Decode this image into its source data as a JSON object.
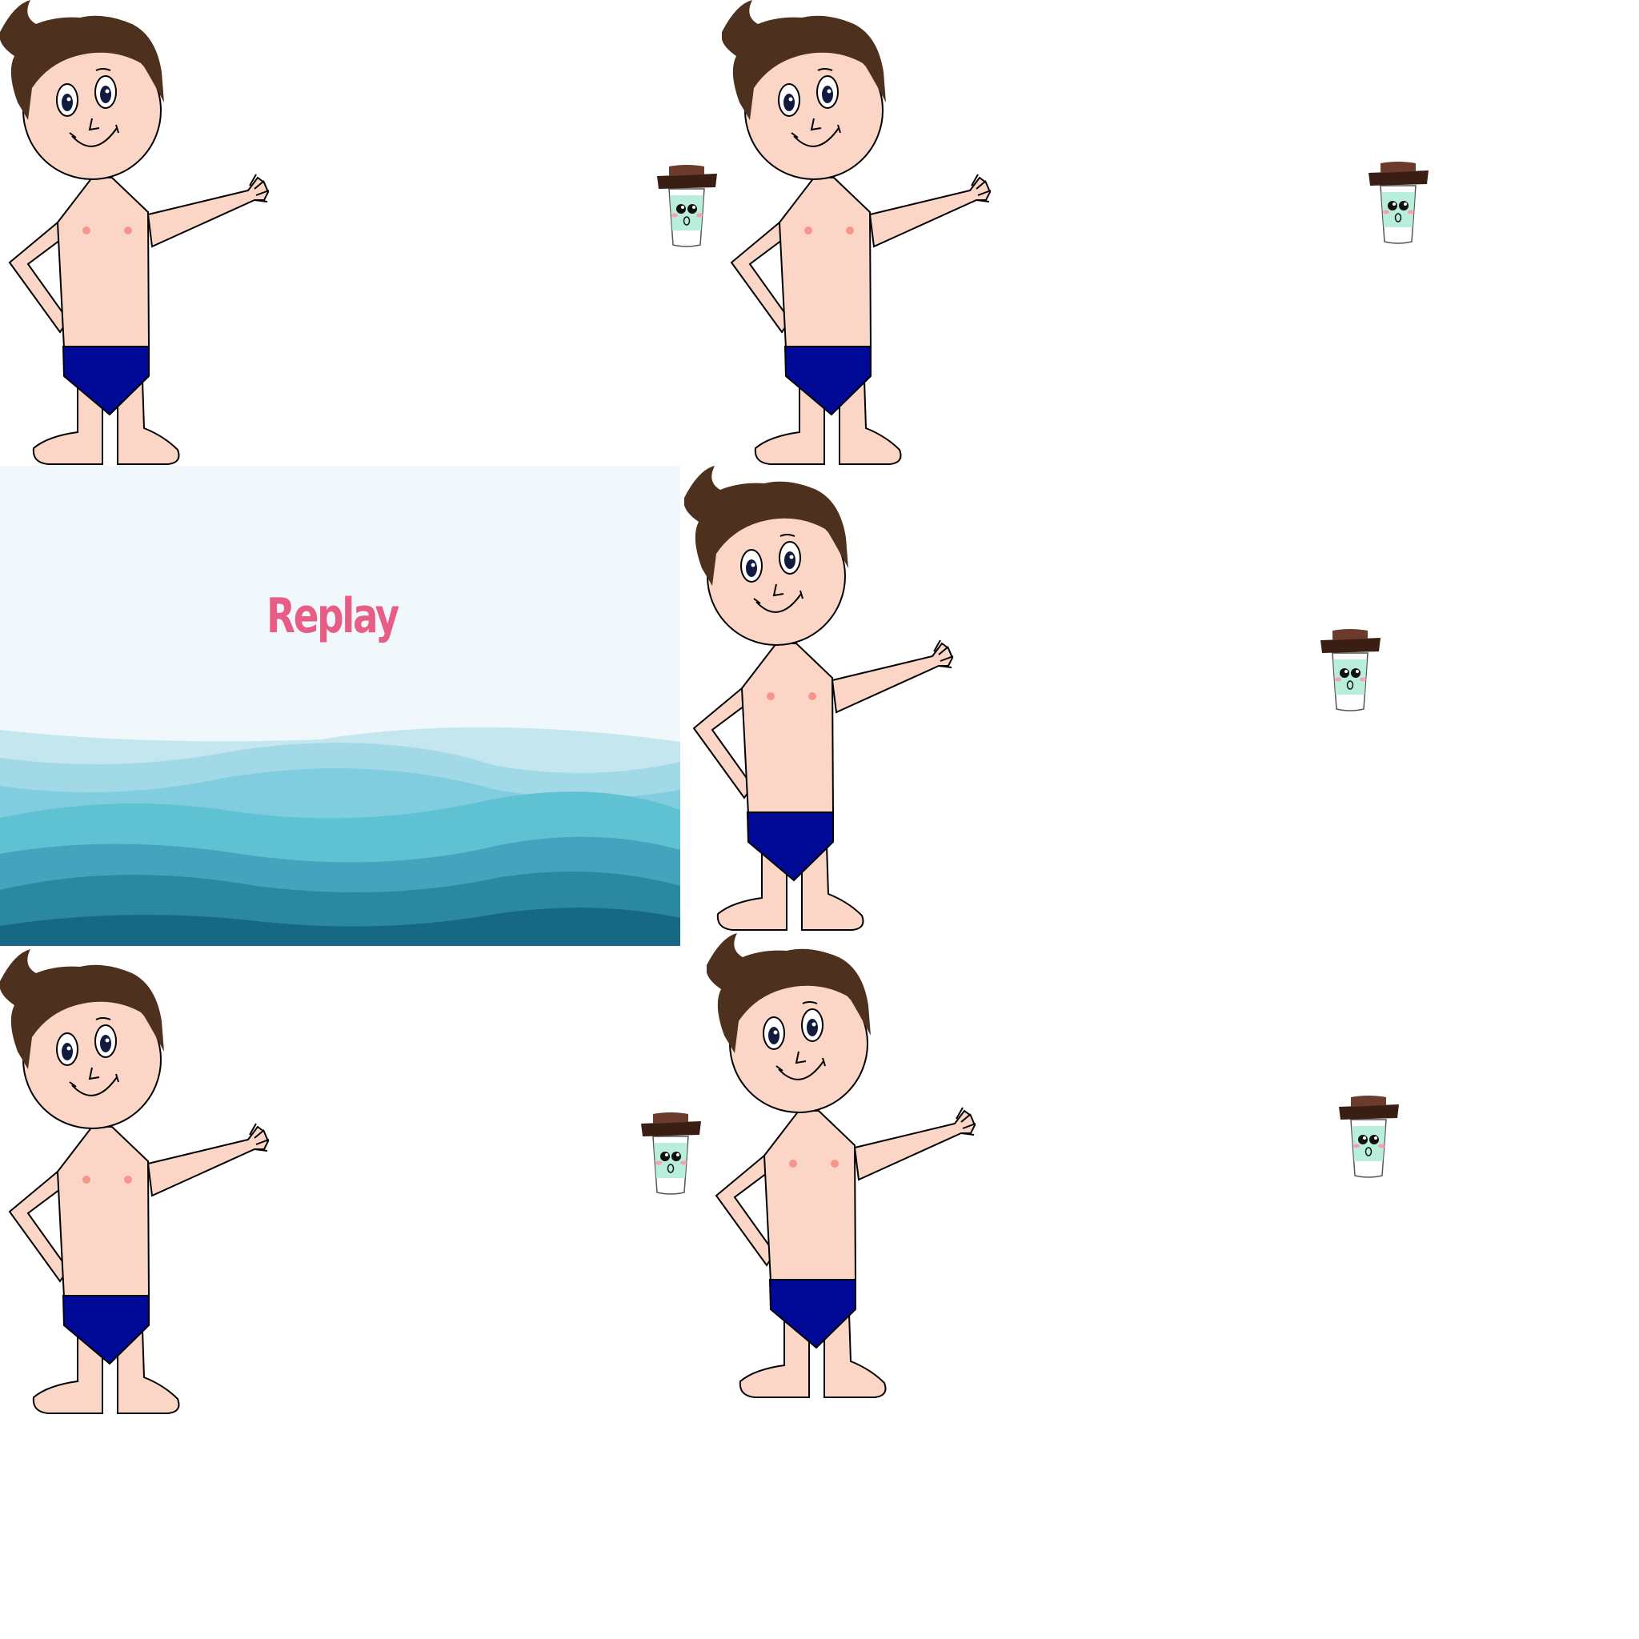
{
  "replay": {
    "label": "Replay"
  },
  "colors": {
    "hair": "#4d301d",
    "skin": "#fbd6c6",
    "briefs": "#000a96",
    "cup_body": "#b9eedb",
    "cup_lid": "#3a1e14",
    "replay_text": "#e85d85",
    "wave_shades": [
      "#c3e6ef",
      "#a1d9e6",
      "#80cddf",
      "#5fc2d2",
      "#44a3bd",
      "#2a88a1",
      "#176882"
    ]
  },
  "sprites": {
    "characters": [
      {
        "icon": "boy-character-icon"
      },
      {
        "icon": "boy-character-icon"
      },
      {
        "icon": "boy-character-icon"
      },
      {
        "icon": "boy-character-icon"
      },
      {
        "icon": "boy-character-icon"
      }
    ],
    "cups": [
      {
        "icon": "coffee-cup-icon"
      },
      {
        "icon": "coffee-cup-icon"
      },
      {
        "icon": "coffee-cup-icon"
      },
      {
        "icon": "coffee-cup-icon"
      },
      {
        "icon": "coffee-cup-icon"
      }
    ]
  }
}
